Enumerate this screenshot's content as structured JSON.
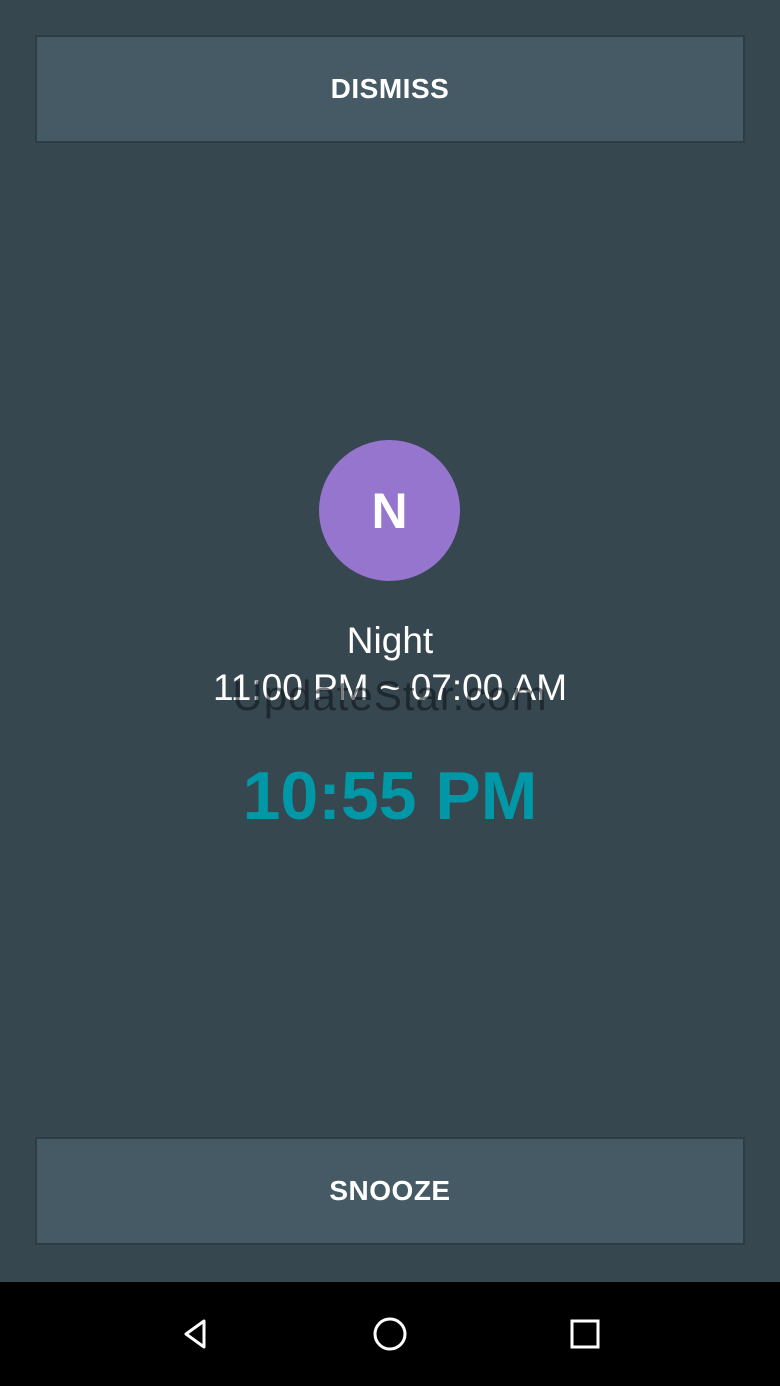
{
  "buttons": {
    "dismiss_label": "DISMISS",
    "snooze_label": "SNOOZE"
  },
  "alarm": {
    "avatar_letter": "N",
    "name": "Night",
    "range": "11:00 PM ~ 07:00 AM"
  },
  "clock": {
    "current_time": "10:55 PM"
  },
  "watermark": {
    "text": "UpdateStar.com"
  },
  "navbar": {
    "icons": [
      "back-icon",
      "home-icon",
      "recents-icon"
    ]
  },
  "colors": {
    "background": "#37474f",
    "button": "#455a64",
    "avatar": "#9575cd",
    "time_accent": "#0097a7",
    "navbar": "#000000"
  }
}
